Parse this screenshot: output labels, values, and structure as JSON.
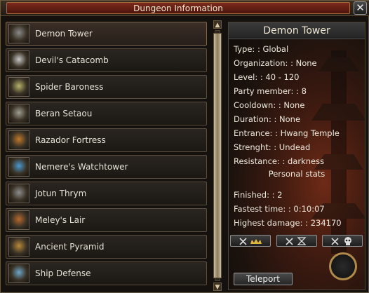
{
  "window": {
    "title": "Dungeon Information",
    "close_label": "✕"
  },
  "dungeons": [
    {
      "name": "Demon Tower",
      "selected": true,
      "icon": "demon-tower-thumb",
      "color": "#8a8a8a"
    },
    {
      "name": "Devil's Catacomb",
      "selected": false,
      "icon": "devils-catacomb-thumb",
      "color": "#c9c9c9"
    },
    {
      "name": "Spider Baroness",
      "selected": false,
      "icon": "spider-baroness-thumb",
      "color": "#b7b36b"
    },
    {
      "name": "Beran Setaou",
      "selected": false,
      "icon": "beran-setaou-thumb",
      "color": "#9f9f8f"
    },
    {
      "name": "Razador Fortress",
      "selected": false,
      "icon": "razador-fortress-thumb",
      "color": "#c27a2a"
    },
    {
      "name": "Nemere's Watchtower",
      "selected": false,
      "icon": "nemere-watchtower-thumb",
      "color": "#4a9ad0"
    },
    {
      "name": "Jotun Thrym",
      "selected": false,
      "icon": "jotun-thrym-thumb",
      "color": "#8d8d8d"
    },
    {
      "name": "Meley's Lair",
      "selected": false,
      "icon": "meley-lair-thumb",
      "color": "#b9692e"
    },
    {
      "name": "Ancient Pyramid",
      "selected": false,
      "icon": "ancient-pyramid-thumb",
      "color": "#b98a3a"
    },
    {
      "name": "Ship Defense",
      "selected": false,
      "icon": "ship-defense-thumb",
      "color": "#6ea7c9"
    }
  ],
  "info": {
    "title": "Demon Tower",
    "fields": [
      {
        "label": "Type: ",
        "value": ": Global"
      },
      {
        "label": "Organization: ",
        "value": ": None"
      },
      {
        "label": "Level: ",
        "value": ": 40 - 120"
      },
      {
        "label": "Party member: ",
        "value": ": 8"
      },
      {
        "label": "Cooldown: ",
        "value": ": None"
      },
      {
        "label": "Duration: ",
        "value": ": None"
      },
      {
        "label": "Entrance: ",
        "value": ": Hwang Temple"
      },
      {
        "label": "Strenght: ",
        "value": ": Undead"
      },
      {
        "label": "Resistance: ",
        "value": ": darkness"
      }
    ],
    "personal_stats_title": "Personal stats",
    "stats": [
      {
        "label": "Finished: ",
        "value": ": 2"
      },
      {
        "label": "Fastest time: ",
        "value": ": 0:10:07"
      },
      {
        "label": "Highest damage: ",
        "value": ": 234170"
      }
    ],
    "ranking_buttons": [
      "rank-crown-icon",
      "rank-hourglass-icon",
      "rank-skull-icon"
    ],
    "teleport_label": "Teleport"
  },
  "colors": {
    "accent_gold": "#b08a4a",
    "title_red": "#7b2a1c"
  }
}
